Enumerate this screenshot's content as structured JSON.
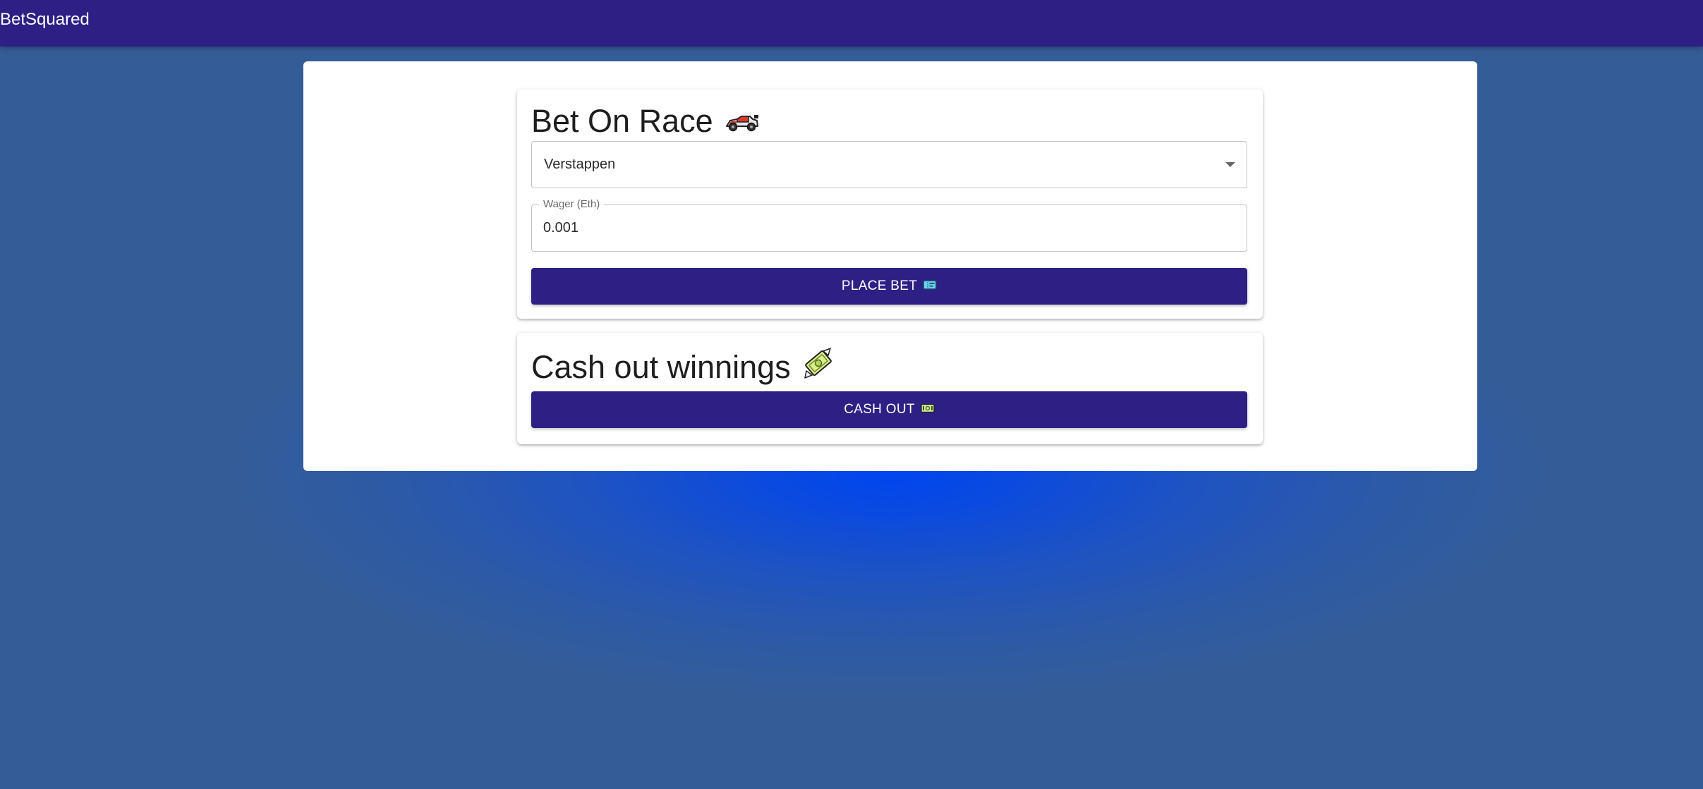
{
  "appbar": {
    "title": "BetSquared"
  },
  "bet_card": {
    "title": "Bet On Race",
    "title_icon": "race-car-icon",
    "driver_select": {
      "selected": "Verstappen"
    },
    "wager_field": {
      "label": "Wager (Eth)",
      "value": "0.001"
    },
    "place_bet_button": {
      "label": "PLACE BET",
      "icon": "ticket-icon"
    }
  },
  "cash_card": {
    "title": "Cash out winnings",
    "title_icon": "money-with-wings-icon",
    "cash_out_button": {
      "label": "CASH OUT",
      "icon": "banknote-icon"
    }
  },
  "colors": {
    "primary": "#2e1f85",
    "background": "#345d97",
    "glow": "#0045f0",
    "panel": "#ffffff"
  }
}
